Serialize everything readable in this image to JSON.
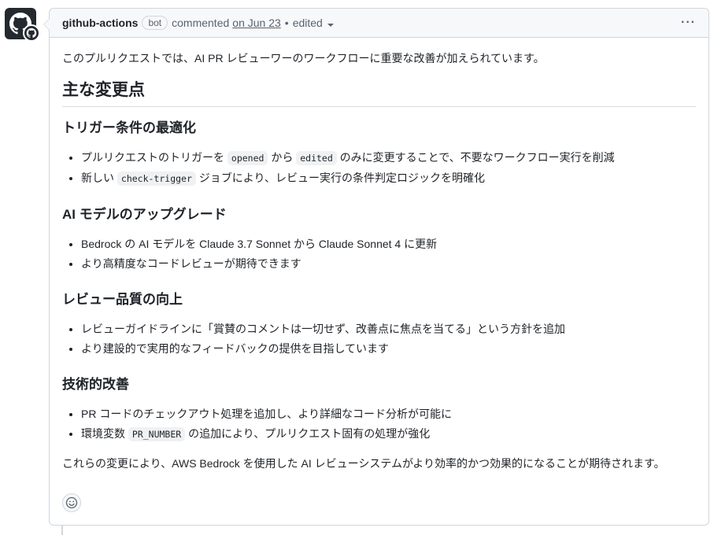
{
  "header": {
    "author": "github-actions",
    "badge": "bot",
    "action": "commented",
    "date": "on Jun 23",
    "separator": "•",
    "edited": "edited",
    "more_icon": "kebab-horizontal-icon",
    "more_label": "···"
  },
  "body": {
    "intro": "このプルリクエストでは、AI PR レビューワーのワークフローに重要な改善が加えられています。",
    "heading": "主な変更点",
    "sections": [
      {
        "title": "トリガー条件の最適化",
        "items": [
          {
            "t1": "プルリクエストのトリガーを ",
            "c1": "opened",
            "t2": " から ",
            "c2": "edited",
            "t3": " のみに変更することで、不要なワークフロー実行を削減"
          },
          {
            "t1": "新しい ",
            "c1": "check-trigger",
            "t2": " ジョブにより、レビュー実行の条件判定ロジックを明確化"
          }
        ]
      },
      {
        "title": "AI モデルのアップグレード",
        "items": [
          {
            "t1": "Bedrock の AI モデルを Claude 3.7 Sonnet から Claude Sonnet 4 に更新"
          },
          {
            "t1": "より高精度なコードレビューが期待できます"
          }
        ]
      },
      {
        "title": "レビュー品質の向上",
        "items": [
          {
            "t1": "レビューガイドラインに「賞賛のコメントは一切せず、改善点に焦点を当てる」という方針を追加"
          },
          {
            "t1": "より建設的で実用的なフィードバックの提供を目指しています"
          }
        ]
      },
      {
        "title": "技術的改善",
        "items": [
          {
            "t1": "PR コードのチェックアウト処理を追加し、より詳細なコード分析が可能に"
          },
          {
            "t1": "環境変数 ",
            "c1": "PR_NUMBER",
            "t2": " の追加により、プルリクエスト固有の処理が強化"
          }
        ]
      }
    ],
    "conclusion": "これらの変更により、AWS Bedrock を使用した AI レビューシステムがより効率的かつ効果的になることが期待されます。"
  },
  "icons": {
    "avatar": "github-mark-icon",
    "reaction": "smiley-icon"
  },
  "colors": {
    "border": "#d0d7de",
    "header_bg": "#f6f8fa",
    "text": "#1f2328",
    "muted": "#59636e"
  }
}
